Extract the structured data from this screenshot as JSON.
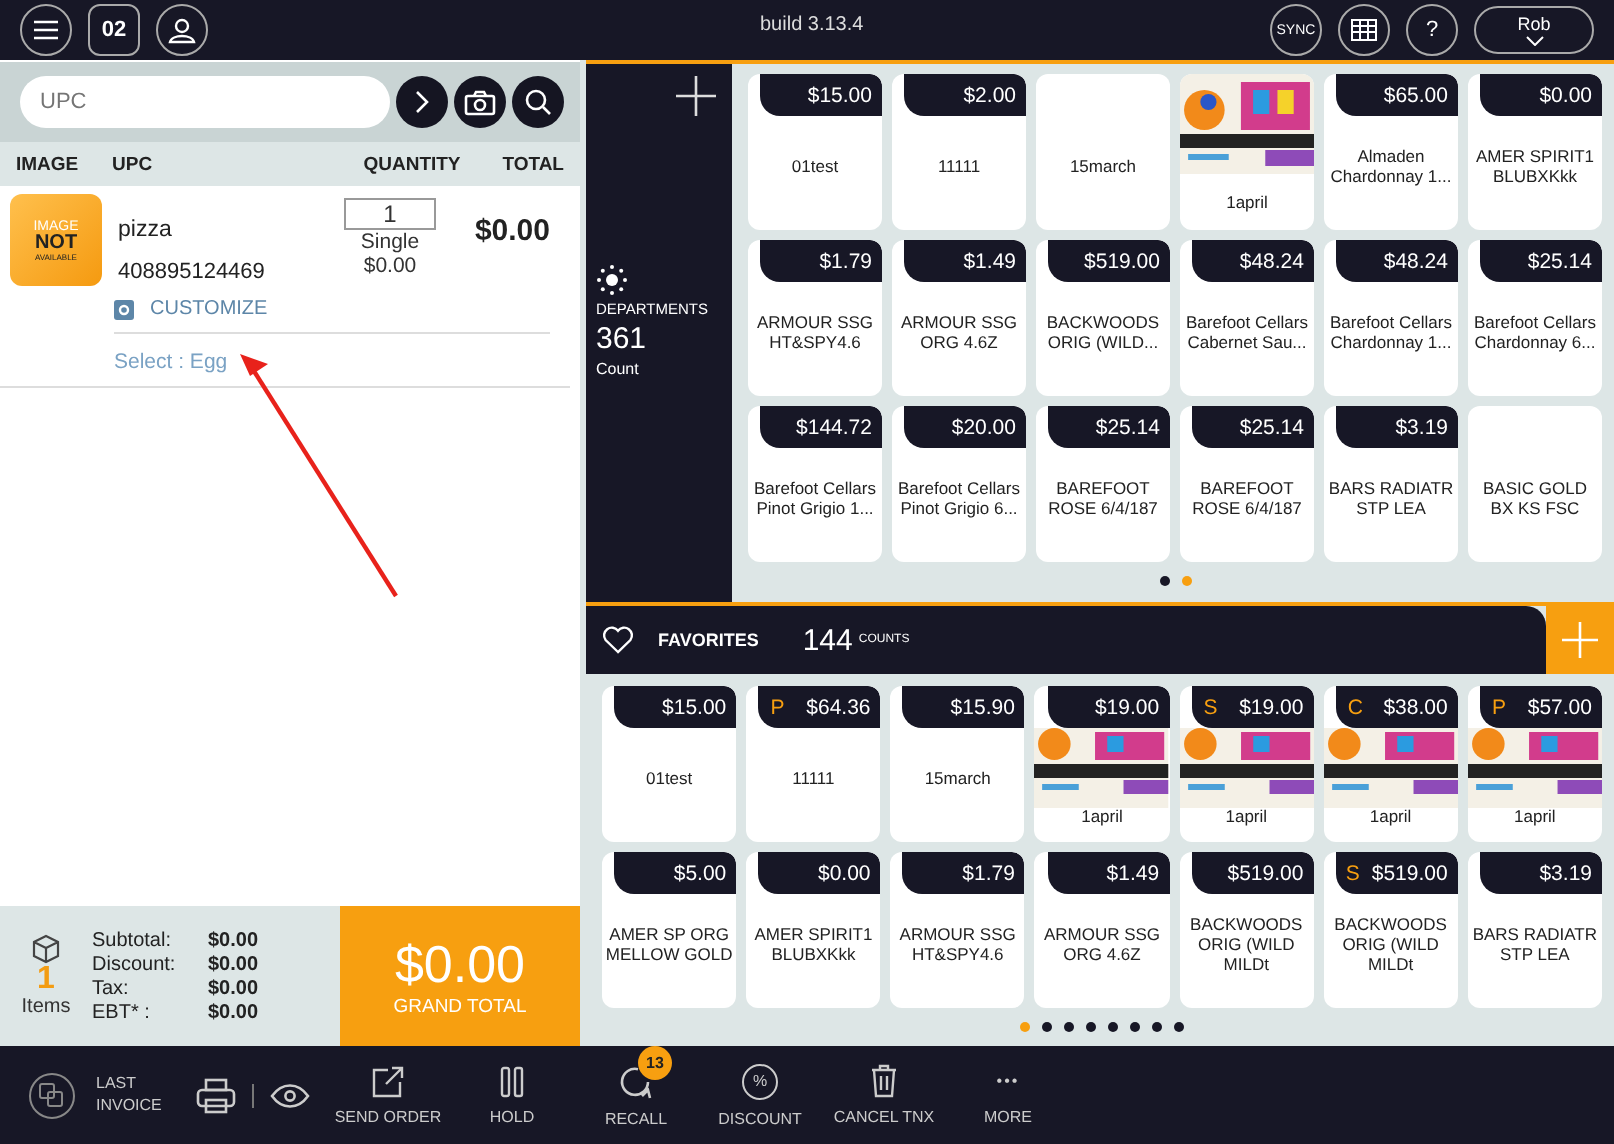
{
  "header": {
    "build": "build 3.13.4",
    "register": "02",
    "sync": "SYNC",
    "help": "?",
    "user": "Rob"
  },
  "search": {
    "placeholder": "UPC"
  },
  "columns": [
    "IMAGE",
    "UPC",
    "QUANTITY",
    "TOTAL"
  ],
  "cart": [
    {
      "image_text": [
        "IMAGE",
        "NOT",
        "AVAILABLE"
      ],
      "name": "pizza",
      "upc": "408895124469",
      "quantity": "1",
      "unit": "Single",
      "unit_price": "$0.00",
      "total": "$0.00",
      "customize": "CUSTOMIZE",
      "modifier": "Select : Egg"
    }
  ],
  "annotation": {
    "kind": "arrow"
  },
  "summary": {
    "count": "1",
    "count_label": "Items",
    "lines": [
      {
        "label": "Subtotal:",
        "value": "$0.00"
      },
      {
        "label": "Discount:",
        "value": "$0.00"
      },
      {
        "label": "Tax:",
        "value": "$0.00"
      },
      {
        "label": "EBT* :",
        "value": "$0.00"
      }
    ],
    "grand_total": "$0.00",
    "grand_total_label": "GRAND TOTAL"
  },
  "departments": {
    "label": "DEPARTMENTS",
    "count": "361",
    "count_label": "Count",
    "pages": [
      {
        "selected": false
      },
      {
        "selected": true
      }
    ],
    "tiles": [
      {
        "price": "$15.00",
        "name": "01test",
        "picture": false
      },
      {
        "price": "$2.00",
        "name": "11111",
        "picture": false
      },
      {
        "name": "15march",
        "picture": false
      },
      {
        "name": "1april",
        "picture": true
      },
      {
        "price": "$65.00",
        "name": "Almaden Chardonnay 1...",
        "picture": false
      },
      {
        "price": "$0.00",
        "name": "AMER SPIRIT1 BLUBXKkk",
        "picture": false
      },
      {
        "price": "$1.79",
        "name": "ARMOUR SSG HT&SPY4.6",
        "picture": false
      },
      {
        "price": "$1.49",
        "name": "ARMOUR SSG ORG 4.6Z",
        "picture": false
      },
      {
        "price": "$519.00",
        "name": "BACKWOODS ORIG (WILD...",
        "picture": false
      },
      {
        "price": "$48.24",
        "name": "Barefoot Cellars Cabernet Sau...",
        "picture": false
      },
      {
        "price": "$48.24",
        "name": "Barefoot Cellars Chardonnay 1...",
        "picture": false
      },
      {
        "price": "$25.14",
        "name": "Barefoot Cellars Chardonnay 6...",
        "picture": false
      },
      {
        "price": "$144.72",
        "name": "Barefoot Cellars Pinot Grigio 1...",
        "picture": false
      },
      {
        "price": "$20.00",
        "name": "Barefoot Cellars Pinot Grigio 6...",
        "picture": false
      },
      {
        "price": "$25.14",
        "name": "BAREFOOT ROSE 6/4/187",
        "picture": false
      },
      {
        "price": "$25.14",
        "name": "BAREFOOT ROSE 6/4/187",
        "picture": false
      },
      {
        "price": "$3.19",
        "name": "BARS RADIATR STP LEA",
        "picture": false
      },
      {
        "name": "BASIC GOLD BX KS FSC",
        "picture": false
      }
    ]
  },
  "favorites": {
    "label": "FAVORITES",
    "count": "144",
    "count_label": "COUNTS",
    "pages": [
      {
        "selected": true
      },
      {
        "selected": false
      },
      {
        "selected": false
      },
      {
        "selected": false
      },
      {
        "selected": false
      },
      {
        "selected": false
      },
      {
        "selected": false
      },
      {
        "selected": false
      }
    ],
    "tiles": [
      {
        "price": "$15.00",
        "name": "01test",
        "picture": false
      },
      {
        "flag": "P",
        "price": "$64.36",
        "name": "11111",
        "picture": false
      },
      {
        "price": "$15.90",
        "name": "15march",
        "picture": false
      },
      {
        "price": "$19.00",
        "name": "1april",
        "picture": true
      },
      {
        "flag": "S",
        "price": "$19.00",
        "name": "1april",
        "picture": true
      },
      {
        "flag": "C",
        "price": "$38.00",
        "name": "1april",
        "picture": true
      },
      {
        "flag": "P",
        "price": "$57.00",
        "name": "1april",
        "picture": true
      },
      {
        "price": "$5.00",
        "name": "AMER SP ORG MELLOW GOLD",
        "picture": false
      },
      {
        "price": "$0.00",
        "name": "AMER SPIRIT1 BLUBXKkk",
        "picture": false
      },
      {
        "price": "$1.79",
        "name": "ARMOUR SSG HT&SPY4.6",
        "picture": false
      },
      {
        "price": "$1.49",
        "name": "ARMOUR SSG ORG 4.6Z",
        "picture": false
      },
      {
        "price": "$519.00",
        "name": "BACKWOODS ORIG (WILD MILDt",
        "picture": false
      },
      {
        "flag": "S",
        "price": "$519.00",
        "name": "BACKWOODS ORIG (WILD MILDt",
        "picture": false
      },
      {
        "price": "$3.19",
        "name": "BARS RADIATR STP LEA",
        "picture": false
      }
    ]
  },
  "toolbar": [
    {
      "kind": "last",
      "label": "LAST INVOICE"
    },
    {
      "kind": "print"
    },
    {
      "kind": "view"
    },
    {
      "kind": "send",
      "label": "SEND ORDER"
    },
    {
      "kind": "hold",
      "label": "HOLD"
    },
    {
      "kind": "recall",
      "label": "RECALL",
      "badge": "13"
    },
    {
      "kind": "discount",
      "label": "DISCOUNT",
      "symbol": "%"
    },
    {
      "kind": "cancel",
      "label": "CANCEL TNX"
    },
    {
      "kind": "more",
      "label": "MORE",
      "symbol": "•••"
    }
  ]
}
